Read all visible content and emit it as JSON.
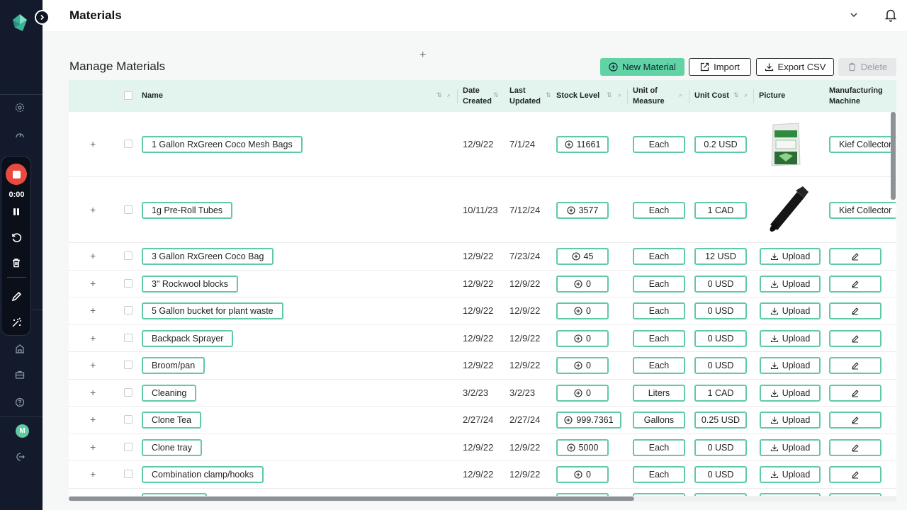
{
  "header": {
    "title": "Materials"
  },
  "page": {
    "section_title": "Manage Materials"
  },
  "actions": {
    "new_label": "New Material",
    "import_label": "Import",
    "export_label": "Export CSV",
    "delete_label": "Delete"
  },
  "recorder": {
    "time": "0:00"
  },
  "user": {
    "initial": "M"
  },
  "colors": {
    "accent": "#5fcaa3",
    "sidebar": "#121a2c",
    "header_row": "#e3f4ef",
    "record": "#e94a3f"
  },
  "table": {
    "columns": {
      "name": "Name",
      "date_created_1": "Date",
      "date_created_2": "Created",
      "last_updated_1": "Last",
      "last_updated_2": "Updated",
      "stock": "Stock Level",
      "unit_1": "Unit of",
      "unit_2": "Measure",
      "cost": "Unit Cost",
      "picture": "Picture",
      "machine_1": "Manufacturing",
      "machine_2": "Machine"
    },
    "upload_label": "Upload",
    "rows": [
      {
        "name": "1 Gallon RxGreen Coco Mesh Bags",
        "created": "12/9/22",
        "updated": "7/1/24",
        "stock": "11661",
        "unit": "Each",
        "cost": "0.2 USD",
        "picture": "coco-bag",
        "machine": "Kief Collector"
      },
      {
        "name": "1g Pre-Roll Tubes",
        "created": "10/11/23",
        "updated": "7/12/24",
        "stock": "3577",
        "unit": "Each",
        "cost": "1 CAD",
        "picture": "pre-roll-tube",
        "machine": "Kief Collector"
      },
      {
        "name": "3 Gallon RxGreen Coco Bag",
        "created": "12/9/22",
        "updated": "7/23/24",
        "stock": "45",
        "unit": "Each",
        "cost": "12 USD"
      },
      {
        "name": "3\" Rockwool blocks",
        "created": "12/9/22",
        "updated": "12/9/22",
        "stock": "0",
        "unit": "Each",
        "cost": "0 USD"
      },
      {
        "name": "5 Gallon bucket for plant waste",
        "created": "12/9/22",
        "updated": "12/9/22",
        "stock": "0",
        "unit": "Each",
        "cost": "0 USD"
      },
      {
        "name": "Backpack Sprayer",
        "created": "12/9/22",
        "updated": "12/9/22",
        "stock": "0",
        "unit": "Each",
        "cost": "0 USD"
      },
      {
        "name": "Broom/pan",
        "created": "12/9/22",
        "updated": "12/9/22",
        "stock": "0",
        "unit": "Each",
        "cost": "0 USD"
      },
      {
        "name": "Cleaning",
        "created": "3/2/23",
        "updated": "3/2/23",
        "stock": "0",
        "unit": "Liters",
        "cost": "1 CAD"
      },
      {
        "name": "Clone Tea",
        "created": "2/27/24",
        "updated": "2/27/24",
        "stock": "999.7361",
        "unit": "Gallons",
        "cost": "0.25 USD"
      },
      {
        "name": "Clone tray",
        "created": "12/9/22",
        "updated": "12/9/22",
        "stock": "5000",
        "unit": "Each",
        "cost": "0 USD"
      },
      {
        "name": "Combination clamp/hooks",
        "created": "12/9/22",
        "updated": "12/9/22",
        "stock": "0",
        "unit": "Each",
        "cost": "0 USD"
      }
    ]
  }
}
